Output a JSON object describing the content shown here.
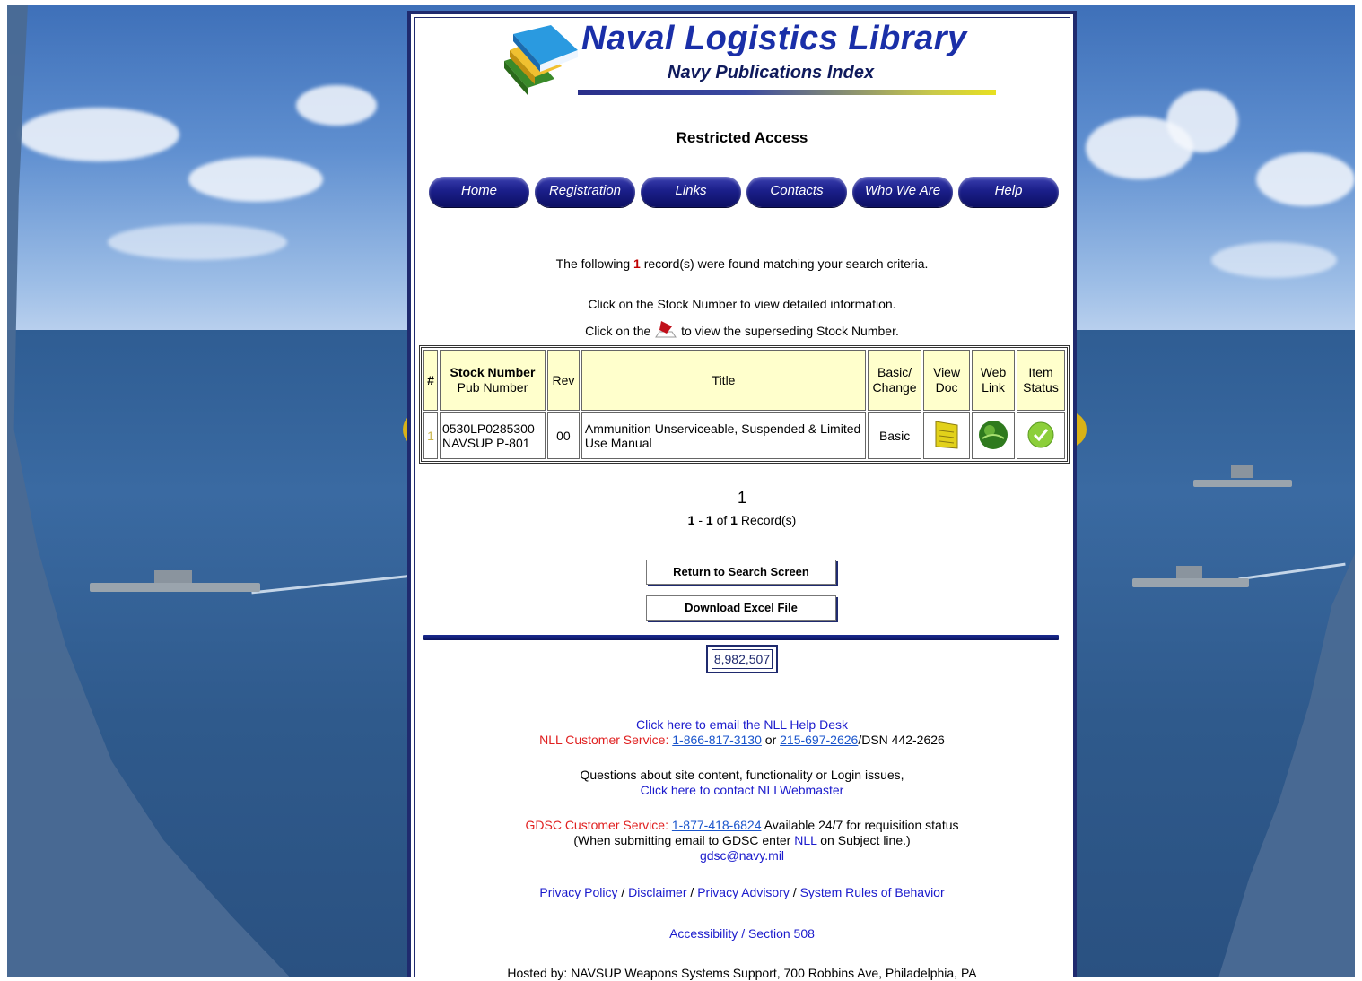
{
  "header": {
    "title": "Naval Logistics Library",
    "subtitle": "Navy Publications Index",
    "restricted": "Restricted Access"
  },
  "nav": [
    {
      "label": "Home"
    },
    {
      "label": "Registration"
    },
    {
      "label": "Links"
    },
    {
      "label": "Contacts"
    },
    {
      "label": "Who We Are"
    },
    {
      "label": "Help"
    }
  ],
  "search_info": {
    "found_prefix": "The following",
    "found_count": "1",
    "found_suffix": "record(s) were found matching your search criteria.",
    "click_stock": "Click on the Stock Number to view detailed information.",
    "click_flag_prefix": "Click on the",
    "click_flag_suffix": "to view the superseding Stock Number."
  },
  "table": {
    "headers": {
      "num": "#",
      "stock_number": "Stock Number",
      "pub_number": "Pub Number",
      "rev": "Rev",
      "title": "Title",
      "basic_change": "Basic/ Change",
      "view_doc": "View Doc",
      "web_link": "Web Link",
      "item_status": "Item Status"
    },
    "rows": [
      {
        "num": "1",
        "stock_number": "0530LP0285300",
        "pub_number": "NAVSUP P-801",
        "rev": "00",
        "title": "Ammunition Unserviceable, Suspended & Limited Use Manual",
        "basic_change": "Basic",
        "view_doc_icon": "document-icon",
        "web_link_icon": "globe-icon",
        "status_icon": "check-icon"
      }
    ]
  },
  "pager": {
    "page": "1",
    "range_start": "1",
    "range_end": "1",
    "total": "1",
    "records_label": "Record(s)"
  },
  "buttons": {
    "return": "Return to Search Screen",
    "download": "Download Excel File"
  },
  "counter": "8,982,507",
  "footer": {
    "email_help": "Click here to email the NLL Help Desk",
    "nll_cs_label": "NLL Customer Service:",
    "nll_phone1": "1-866-817-3130",
    "or": "or",
    "nll_phone2": "215-697-2626",
    "dsn": "/DSN 442-2626",
    "questions": "Questions about site content, functionality or Login issues,",
    "contact_webmaster": "Click here to contact NLLWebmaster",
    "gdsc_label": "GDSC Customer Service:",
    "gdsc_phone": "1-877-418-6824",
    "gdsc_available": "Available 24/7 for requisition status",
    "gdsc_note_prefix": "(When submitting email to GDSC enter",
    "gdsc_note_nll": "NLL",
    "gdsc_note_suffix": "on Subject line.)",
    "gdsc_email": "gdsc@navy.mil",
    "privacy_policy": "Privacy Policy",
    "disclaimer": "Disclaimer",
    "privacy_advisory": "Privacy Advisory",
    "system_rules": "System Rules of Behavior",
    "accessibility": "Accessibility / Section 508",
    "hosted": "Hosted by: NAVSUP Weapons Systems Support, 700 Robbins Ave, Philadelphia, PA"
  },
  "colors": {
    "nav_button": "#1b1f8a",
    "title_blue": "#1a2fa8",
    "table_header_bg": "#ffffcc",
    "highlight": "#f6c000",
    "alert_red": "#e02020"
  }
}
